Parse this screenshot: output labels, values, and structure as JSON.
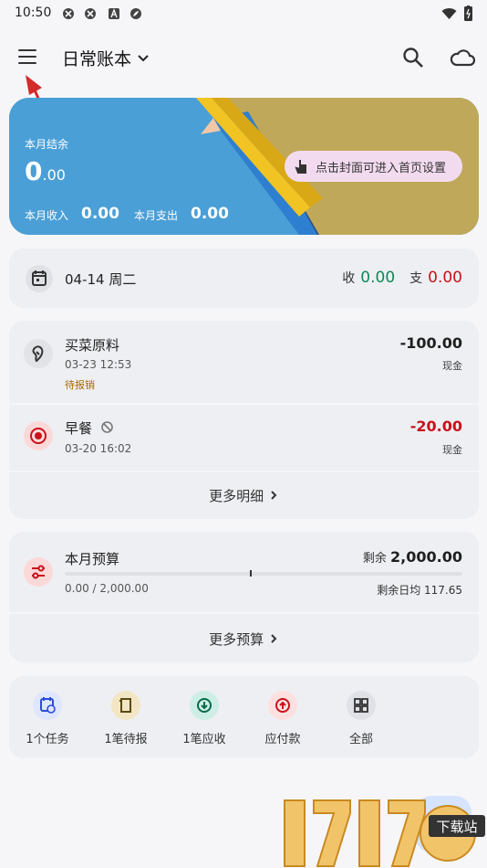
{
  "status_bar": {
    "time": "10:50"
  },
  "header": {
    "title": "日常账本"
  },
  "cover": {
    "balance_label": "本月结余",
    "balance_int": "0",
    "balance_dec": ".00",
    "income_label": "本月收入",
    "income_value": "0.00",
    "expense_label": "本月支出",
    "expense_value": "0.00",
    "tip": "点击封面可进入首页设置"
  },
  "day_summary": {
    "date": "04-14 周二",
    "income_label": "收",
    "income_value": "0.00",
    "expense_label": "支",
    "expense_value": "0.00"
  },
  "transactions": [
    {
      "name": "买菜原料",
      "time": "03-23 12:53",
      "tag": "待报销",
      "amount": "-100.00",
      "account": "现金"
    },
    {
      "name": "早餐",
      "time": "03-20 16:02",
      "tag": "",
      "amount": "-20.00",
      "account": "现金"
    }
  ],
  "more_details": "更多明细",
  "budget": {
    "title": "本月预算",
    "remaining_label": "剩余",
    "remaining_value": "2,000.00",
    "progress_text": "0.00 / 2,000.00",
    "daily_avg": "剩余日均 117.65",
    "progress_fraction": 0.0,
    "more": "更多预算"
  },
  "quick_actions": [
    {
      "label": "1个任务",
      "icon": "calendar-clock-icon",
      "color": "#dfe6ff"
    },
    {
      "label": "1笔待报",
      "icon": "receipt-icon",
      "color": "#f3e6c4"
    },
    {
      "label": "1笔应收",
      "icon": "arrow-down-circle-icon",
      "color": "#cdeee4"
    },
    {
      "label": "应付款",
      "icon": "arrow-up-circle-icon",
      "color": "#fde0df"
    },
    {
      "label": "全部",
      "icon": "grid-icon",
      "color": "#e0e1e6"
    }
  ],
  "watermark": {
    "text": "下载站"
  },
  "colors": {
    "income": "#0a8a55",
    "expense": "#c8121c",
    "accent": "#4a9dd2"
  }
}
